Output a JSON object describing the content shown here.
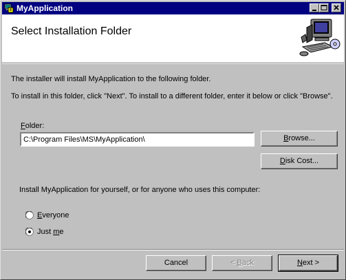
{
  "window": {
    "title": "MyApplication"
  },
  "banner": {
    "heading": "Select Installation Folder"
  },
  "body": {
    "line1": "The installer will install MyApplication to the following folder.",
    "line2": "To install in this folder, click \"Next\". To install to a different folder, enter it below or click \"Browse\"."
  },
  "folder": {
    "label_first": "F",
    "label_rest": "older:",
    "value": "C:\\Program Files\\MS\\MyApplication\\"
  },
  "buttons": {
    "browse_first": "B",
    "browse_rest": "rowse...",
    "diskcost_first": "D",
    "diskcost_rest": "isk Cost...",
    "cancel": "Cancel",
    "back_pre": "< ",
    "back_first": "B",
    "back_rest": "ack",
    "next_first": "N",
    "next_rest": "ext >"
  },
  "scope": {
    "prompt": "Install MyApplication for yourself, or for anyone who uses this computer:",
    "everyone_first": "E",
    "everyone_rest": "veryone",
    "justme_pre": "Just ",
    "justme_first": "m",
    "justme_rest": "e",
    "selected": "Just me"
  },
  "icons": [
    "app-icon",
    "minimize-icon",
    "maximize-icon",
    "close-icon",
    "computer-setup-icon",
    "radio-icon"
  ]
}
